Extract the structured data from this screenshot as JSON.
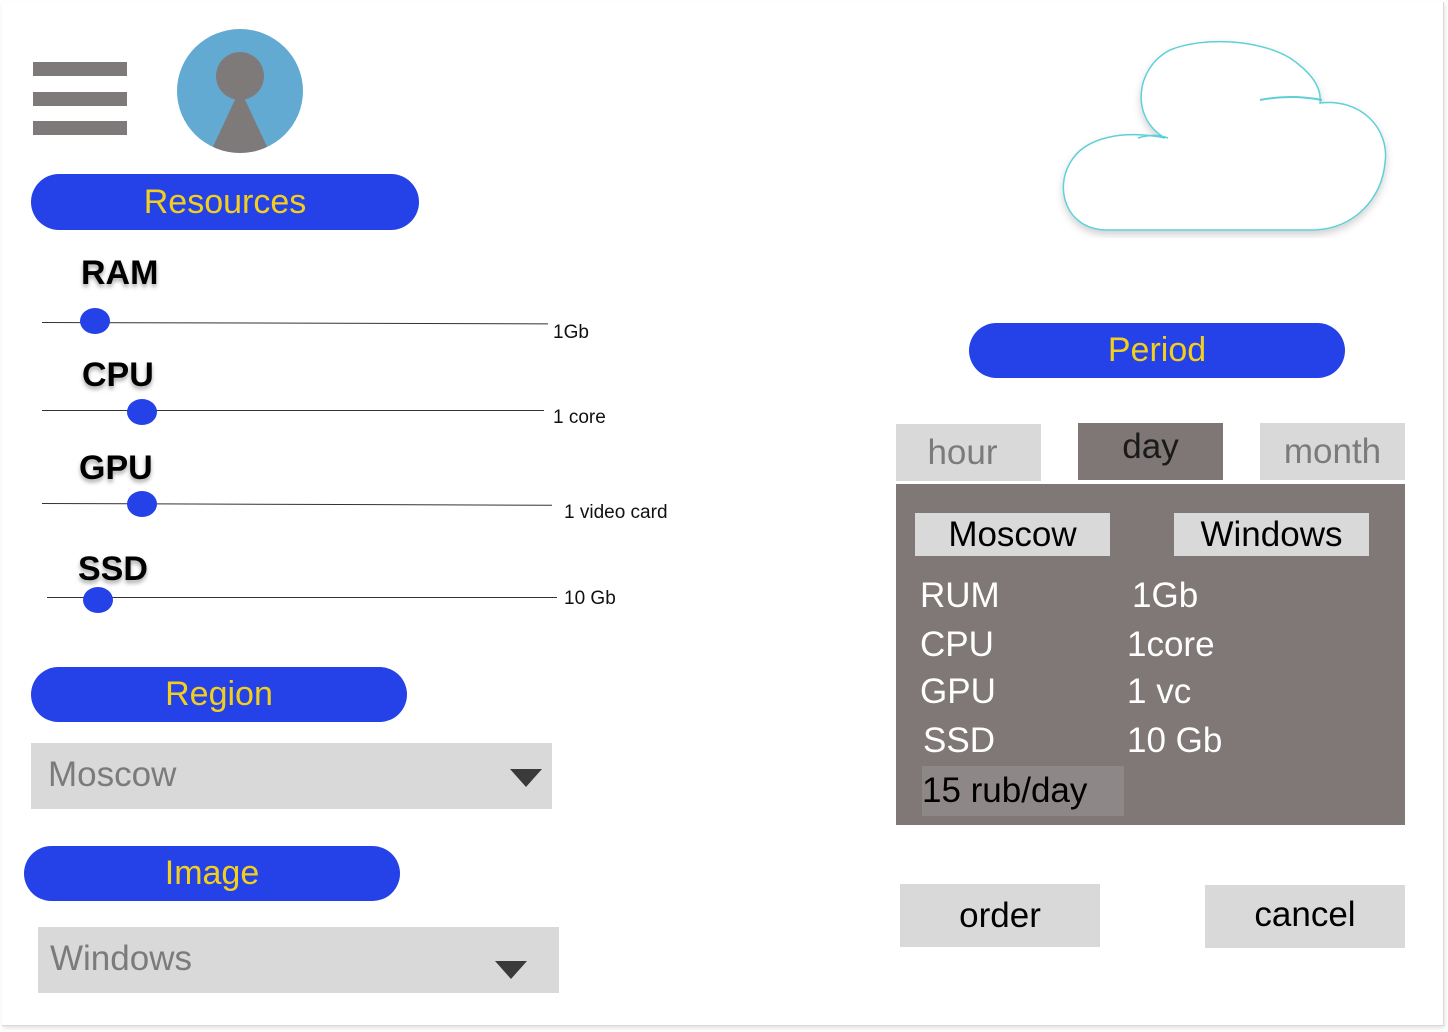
{
  "header": {
    "menu_icon": "hamburger-icon",
    "avatar_icon": "user-avatar-icon",
    "cloud_icon": "cloud-icon"
  },
  "resources": {
    "title": "Resources",
    "sliders": [
      {
        "label": "RAM",
        "value": "1Gb"
      },
      {
        "label": "CPU",
        "value": "1 core"
      },
      {
        "label": "GPU",
        "value": "1 video card"
      },
      {
        "label": "SSD",
        "value": "10 Gb"
      }
    ]
  },
  "region": {
    "title": "Region",
    "selected": "Moscow"
  },
  "image": {
    "title": "Image",
    "selected": "Windows"
  },
  "period": {
    "title": "Period",
    "tabs": [
      {
        "label": "hour",
        "active": false
      },
      {
        "label": "day",
        "active": true
      },
      {
        "label": "month",
        "active": false
      }
    ]
  },
  "summary": {
    "region": "Moscow",
    "image": "Windows",
    "rows": [
      {
        "name": "RUM",
        "value": "1Gb"
      },
      {
        "name": "CPU",
        "value": "1core"
      },
      {
        "name": "GPU",
        "value": "1 vc"
      },
      {
        "name": "SSD",
        "value": "10 Gb"
      }
    ],
    "price": "15 rub/day"
  },
  "actions": {
    "order_label": "order",
    "cancel_label": "cancel"
  },
  "colors": {
    "accent": "#2541e8",
    "accent_text": "#f2cf1d",
    "panel": "#807777",
    "control_gray": "#d9d9d9"
  }
}
